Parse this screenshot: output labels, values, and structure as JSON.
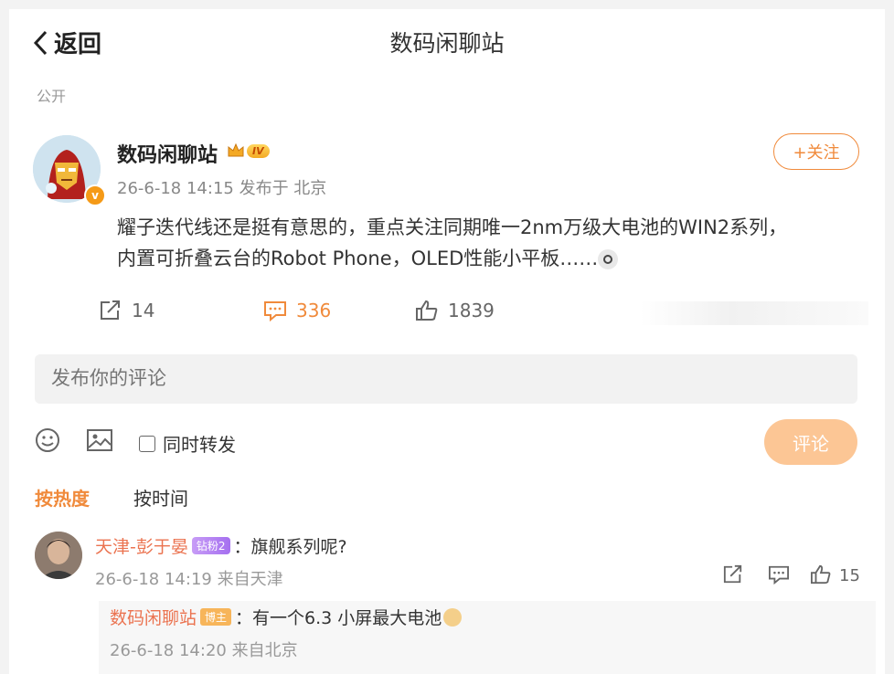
{
  "header": {
    "back_label": "返回",
    "title": "数码闲聊站",
    "visibility": "公开"
  },
  "post": {
    "user_name": "数码闲聊站",
    "level_label": "IV",
    "verified_mark": "v",
    "meta": "26-6-18 14:15 发布于 北京",
    "follow_label": "+关注",
    "content_line1": "耀子迭代线还是挺有意思的，重点关注同期唯一2nm万级大电池的WIN2系列，",
    "content_line2": "内置可折叠云台的Robot Phone，OLED性能小平板……",
    "reposts": "14",
    "comments": "336",
    "likes": "1839"
  },
  "composer": {
    "placeholder": "发布你的评论",
    "repost_label": "同时转发",
    "submit_label": "评论"
  },
  "sort": {
    "hot": "按热度",
    "time": "按时间"
  },
  "comments": [
    {
      "user": "天津-彭于晏",
      "badge": "钻粉2",
      "text": "：旗舰系列呢?",
      "meta": "26-6-18 14:19 来自天津",
      "likes": "15",
      "reply": {
        "user": "数码闲聊站",
        "badge": "博主",
        "text": "：有一个6.3 小屏最大电池",
        "meta": "26-6-18 14:20 来自北京"
      }
    }
  ],
  "colors": {
    "accent": "#f08a3b",
    "comment_user": "#eb7350",
    "submit_disabled": "#fcc695"
  },
  "icons": [
    "chevron-left-icon",
    "repost-icon",
    "comment-icon",
    "like-icon",
    "emoji-icon",
    "image-icon"
  ]
}
